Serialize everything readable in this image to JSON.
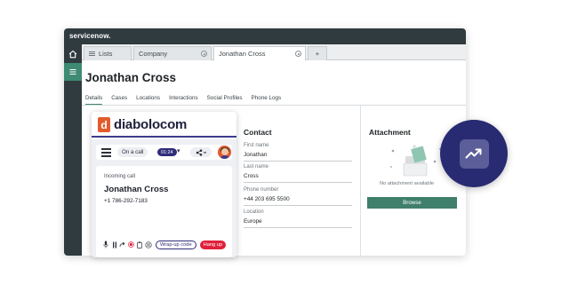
{
  "app": {
    "logo": "servicenow."
  },
  "tabs": [
    {
      "label": "Lists"
    },
    {
      "label": "Company"
    },
    {
      "label": "Jonathan Cross"
    },
    {
      "label": "+"
    }
  ],
  "record": {
    "title": "Jonathan Cross",
    "tabs": [
      "Details",
      "Cases",
      "Locations",
      "Interactions",
      "Social Profiles",
      "Phone Logs"
    ],
    "active_tab": "Details"
  },
  "contact": {
    "heading": "Contact",
    "fields": [
      {
        "label": "First name",
        "value": "Jonathan"
      },
      {
        "label": "Last name",
        "value": "Cross"
      },
      {
        "label": "Phone number",
        "value": "+44 203 695 5500"
      },
      {
        "label": "Location",
        "value": "Europe"
      }
    ]
  },
  "attachment": {
    "heading": "Attachment",
    "empty_text": "No attachment available",
    "browse_label": "Browse"
  },
  "widget": {
    "logo_letter": "d",
    "brand": "diabolocom",
    "status": "On a call",
    "timer": "01:24",
    "incoming_label": "Incoming call",
    "caller_name": "Jonathan Cross",
    "caller_phone": "+1 786-292-7183",
    "wrapup_label": "Wrap-up code",
    "hangup_label": "Hang up"
  },
  "colors": {
    "topbar": "#2f3b3f",
    "accent_green": "#3f8a73",
    "diabolocom_orange": "#e25b2d",
    "diabolocom_navy": "#2f2c7a",
    "hangup_red": "#e0213b",
    "badge_navy": "#282a72"
  },
  "icons": [
    "home-icon",
    "menu-icon",
    "close-tab-icon",
    "hamburger-icon",
    "mic-icon",
    "pause-icon",
    "transfer-icon",
    "record-icon",
    "clipboard-icon",
    "keypad-icon",
    "trend-up-icon"
  ]
}
